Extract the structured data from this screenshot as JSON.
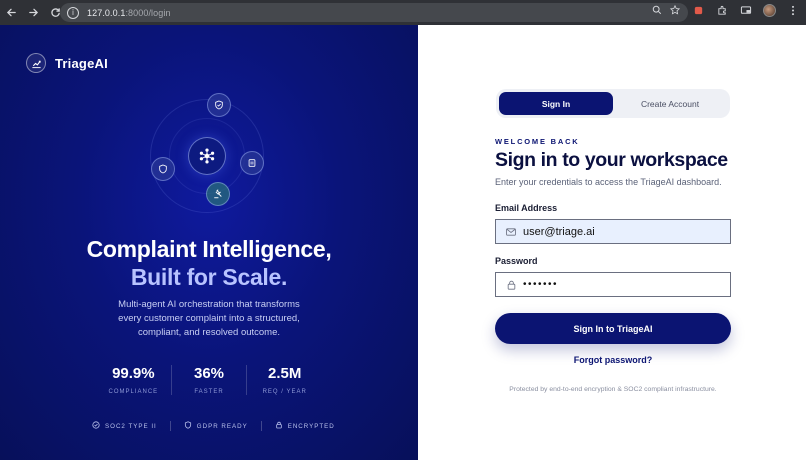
{
  "browser": {
    "url_host": "127.0.0.1",
    "url_path": ":8000/login"
  },
  "brand": {
    "name": "TriageAI"
  },
  "hero": {
    "line1": "Complaint Intelligence,",
    "line2": "Built for Scale.",
    "description": "Multi-agent AI orchestration that transforms every customer complaint into a structured, compliant, and resolved outcome."
  },
  "stats": [
    {
      "value": "99.9%",
      "label": "COMPLIANCE"
    },
    {
      "value": "36%",
      "label": "FASTER"
    },
    {
      "value": "2.5M",
      "label": "REQ / YEAR"
    }
  ],
  "badges": [
    {
      "label": "SOC2 TYPE II",
      "icon": "shield-check-icon"
    },
    {
      "label": "GDPR READY",
      "icon": "shield-icon"
    },
    {
      "label": "ENCRYPTED",
      "icon": "lock-icon"
    }
  ],
  "tabs": [
    {
      "label": "Sign In",
      "active": true
    },
    {
      "label": "Create Account",
      "active": false
    }
  ],
  "form": {
    "eyebrow": "WELCOME BACK",
    "title": "Sign in to your workspace",
    "subtitle": "Enter your credentials to access the TriageAI dashboard.",
    "email_label": "Email Address",
    "email_value": "user@triage.ai",
    "password_label": "Password",
    "password_value": "•••••••",
    "submit_label": "Sign In to TriageAI",
    "forgot_label": "Forgot password?",
    "footnote": "Protected by end-to-end encryption & SOC2 compliant infrastructure."
  },
  "colors": {
    "brand_navy": "#0b1472",
    "hero_accent": "#b8c3ff",
    "panel_bg": "#0a1479"
  }
}
